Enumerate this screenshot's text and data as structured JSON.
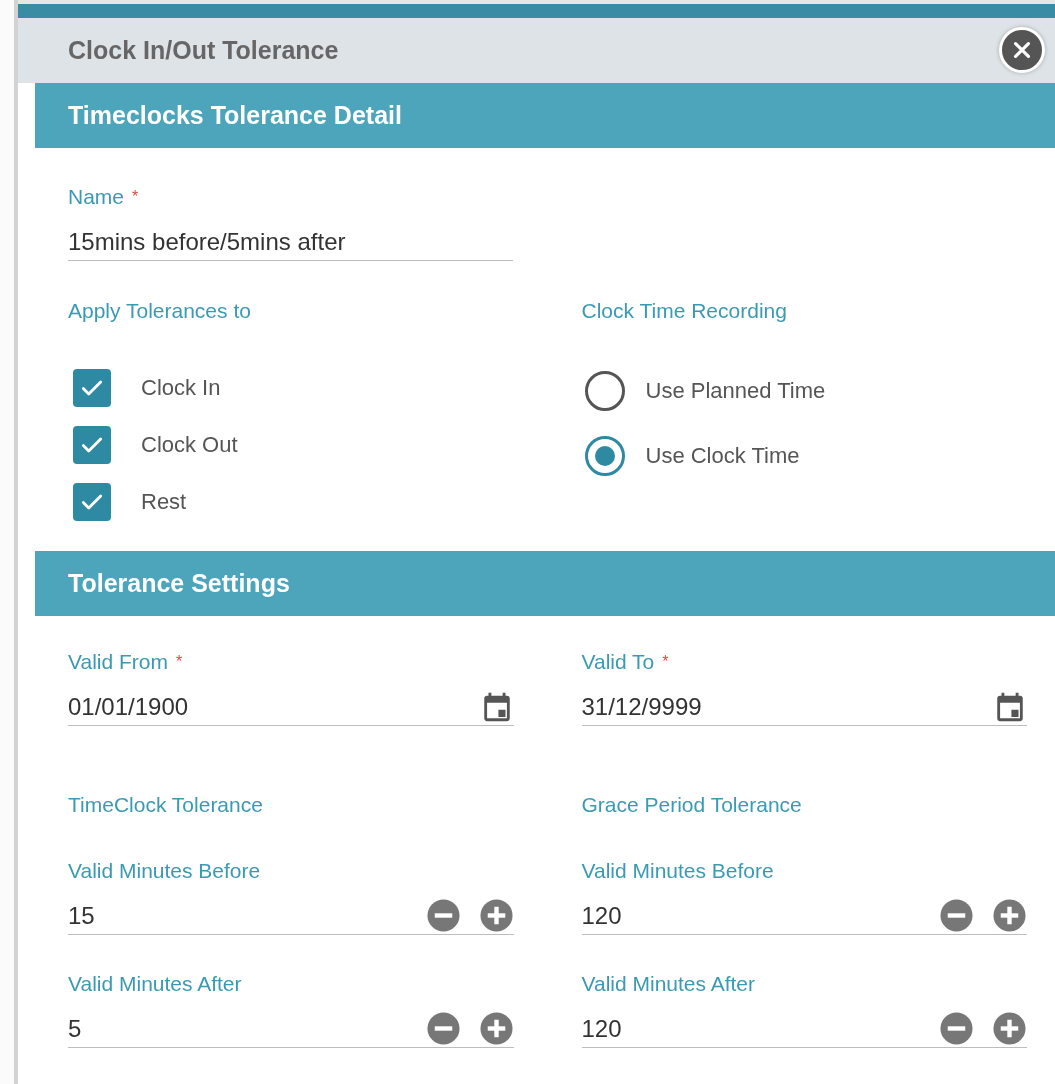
{
  "dialog": {
    "title": "Clock In/Out Tolerance"
  },
  "detail": {
    "title": "Timeclocks Tolerance Detail",
    "name_field": {
      "label": "Name",
      "required_mark": "*",
      "value": "15mins before/5mins after"
    },
    "apply_tolerances": {
      "label": "Apply Tolerances to",
      "options": [
        {
          "label": "Clock In",
          "checked": true
        },
        {
          "label": "Clock Out",
          "checked": true
        },
        {
          "label": "Rest",
          "checked": true
        }
      ]
    },
    "clock_time_recording": {
      "label": "Clock Time Recording",
      "options": [
        {
          "label": "Use Planned Time",
          "selected": false
        },
        {
          "label": "Use Clock Time",
          "selected": true
        }
      ]
    }
  },
  "settings": {
    "title": "Tolerance Settings",
    "dates": [
      {
        "label": "Valid From",
        "required_mark": "*",
        "value": "01/01/1900"
      },
      {
        "label": "Valid To",
        "required_mark": "*",
        "value": "31/12/9999"
      }
    ],
    "groups": [
      {
        "title": "TimeClock Tolerance",
        "fields": [
          {
            "label": "Valid Minutes Before",
            "value": "15"
          },
          {
            "label": "Valid Minutes After",
            "value": "5"
          }
        ]
      },
      {
        "title": "Grace Period Tolerance",
        "fields": [
          {
            "label": "Valid Minutes Before",
            "value": "120"
          },
          {
            "label": "Valid Minutes After",
            "value": "120"
          }
        ]
      }
    ]
  }
}
